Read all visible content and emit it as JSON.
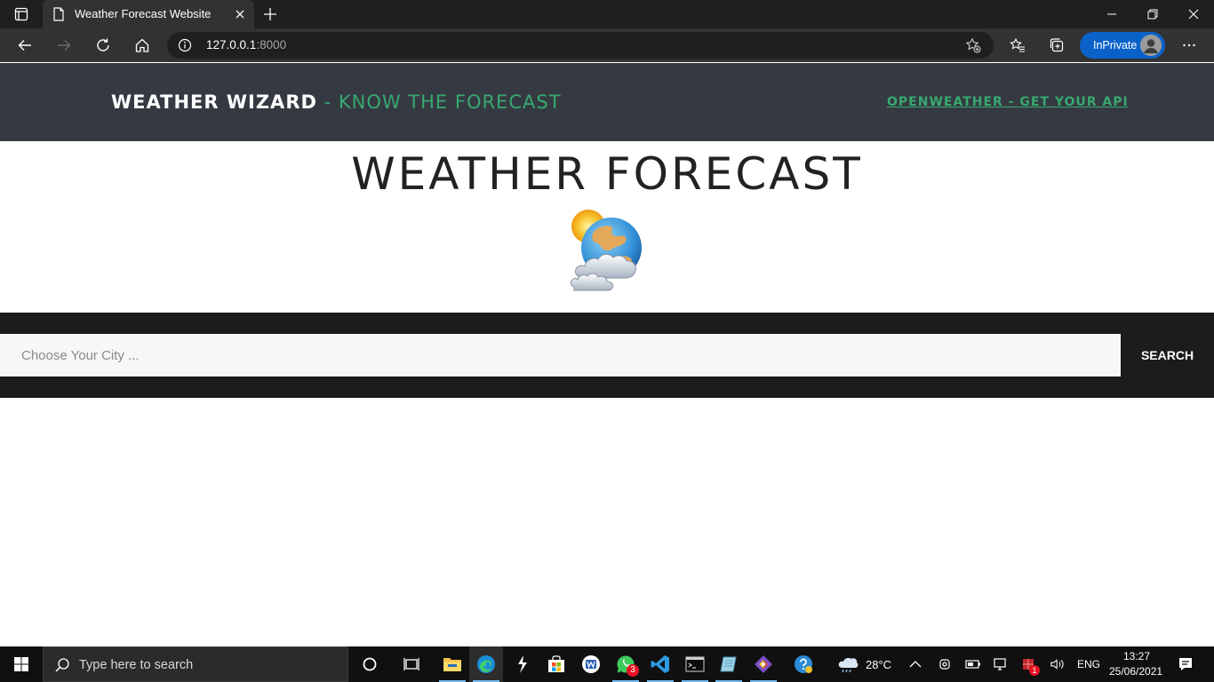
{
  "browser": {
    "tab_title": "Weather Forecast Website",
    "url_host": "127.0.0.1",
    "url_port": ":8000",
    "inprivate_label": "InPrivate"
  },
  "site": {
    "brand_main": "WEATHER WIZARD",
    "brand_sub": " - KNOW THE FORECAST",
    "api_link": "OPENWEATHER - GET YOUR API",
    "hero_title": "WEATHER FORECAST",
    "search_placeholder": "Choose Your City ...",
    "search_button": "SEARCH"
  },
  "taskbar": {
    "search_text": "Type here to search",
    "weather_temp": "28°C",
    "language": "ENG",
    "time": "13:27",
    "date": "25/06/2021",
    "whatsapp_badge": "3",
    "red_badge": "1"
  },
  "colors": {
    "header_bg": "#353a42",
    "accent_green": "#38a870",
    "search_band_bg": "#1c1c1c",
    "inprivate_blue": "#0a62c9"
  }
}
